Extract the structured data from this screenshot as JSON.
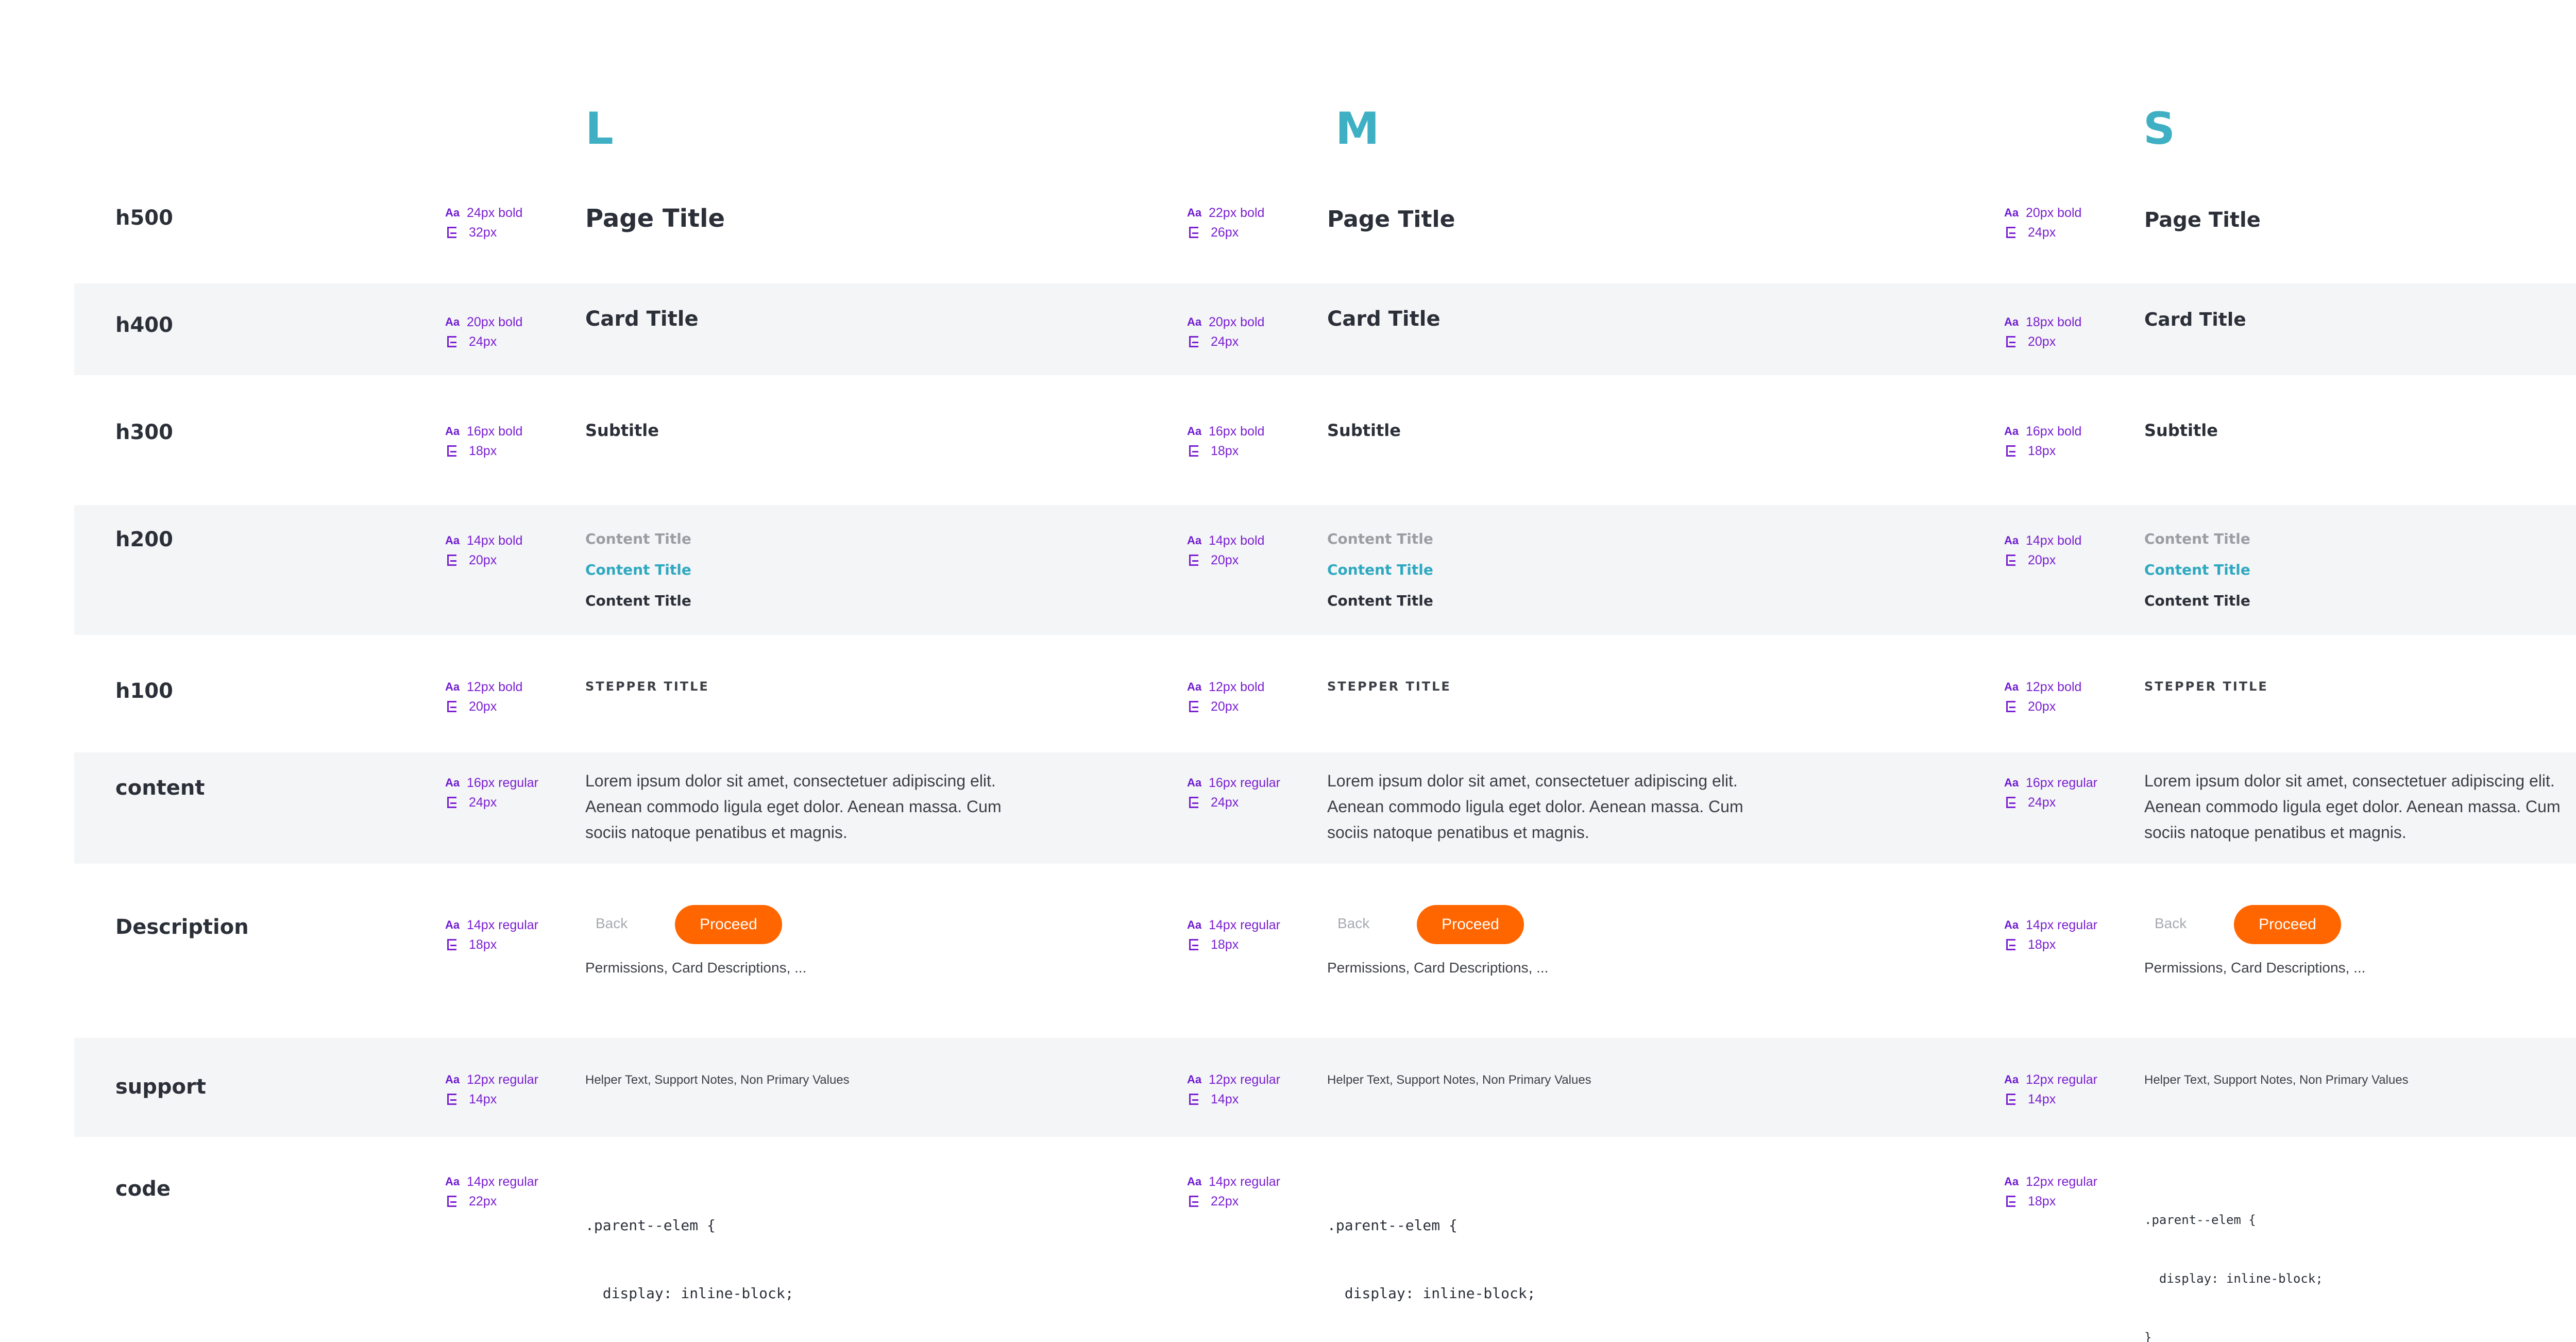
{
  "columns": [
    {
      "id": "L",
      "label": "L"
    },
    {
      "id": "M",
      "label": "M"
    },
    {
      "id": "S",
      "label": "S"
    }
  ],
  "rows": {
    "h500": {
      "label": "h500",
      "specs": {
        "L": [
          "24px bold",
          "32px"
        ],
        "M": [
          "22px bold",
          "26px"
        ],
        "S": [
          "20px bold",
          "24px"
        ]
      },
      "sample": "Page Title"
    },
    "h400": {
      "label": "h400",
      "specs": {
        "L": [
          "20px bold",
          "24px"
        ],
        "M": [
          "20px bold",
          "24px"
        ],
        "S": [
          "18px bold",
          "20px"
        ]
      },
      "sample": "Card Title"
    },
    "h300": {
      "label": "h300",
      "specs": {
        "L": [
          "16px bold",
          "18px"
        ],
        "M": [
          "16px bold",
          "18px"
        ],
        "S": [
          "16px bold",
          "18px"
        ]
      },
      "sample": "Subtitle"
    },
    "h200": {
      "label": "h200",
      "specs": {
        "L": [
          "14px bold",
          "20px"
        ],
        "M": [
          "14px bold",
          "20px"
        ],
        "S": [
          "14px bold",
          "20px"
        ]
      },
      "samples": [
        "Content Title",
        "Content Title",
        "Content Title"
      ]
    },
    "h100": {
      "label": "h100",
      "specs": {
        "L": [
          "12px bold",
          "20px"
        ],
        "M": [
          "12px bold",
          "20px"
        ],
        "S": [
          "12px bold",
          "20px"
        ]
      },
      "sample": "STEPPER TITLE"
    },
    "content": {
      "label": "content",
      "specs": {
        "L": [
          "16px regular",
          "24px"
        ],
        "M": [
          "16px regular",
          "24px"
        ],
        "S": [
          "16px regular",
          "24px"
        ]
      },
      "lines": [
        "Lorem ipsum dolor sit amet, consectetuer adipiscing elit.",
        "Aenean commodo ligula eget dolor. Aenean massa. Cum",
        "sociis natoque penatibus et magnis."
      ]
    },
    "description": {
      "label": "Description",
      "specs": {
        "L": [
          "14px regular",
          "18px"
        ],
        "M": [
          "14px regular",
          "18px"
        ],
        "S": [
          "14px regular",
          "18px"
        ]
      },
      "back_label": "Back",
      "proceed_label": "Proceed",
      "sample": "Permissions, Card Descriptions, ..."
    },
    "support": {
      "label": "support",
      "specs": {
        "L": [
          "12px regular",
          "14px"
        ],
        "M": [
          "12px regular",
          "14px"
        ],
        "S": [
          "12px regular",
          "14px"
        ]
      },
      "sample": "Helper Text, Support Notes, Non Primary Values"
    },
    "code": {
      "label": "code",
      "specs": {
        "L": [
          "14px regular",
          "22px"
        ],
        "M": [
          "14px regular",
          "22px"
        ],
        "S": [
          "12px regular",
          "18px"
        ]
      },
      "lines": [
        ".parent--elem {",
        "  display: inline-block;",
        "}"
      ]
    }
  },
  "spec_icon_label": "Aa",
  "colors": {
    "accent_teal": "#3fb0c4",
    "spec_purple": "#7a1fd1",
    "proceed_orange": "#ff6600",
    "row_shade": "#f4f5f7"
  }
}
